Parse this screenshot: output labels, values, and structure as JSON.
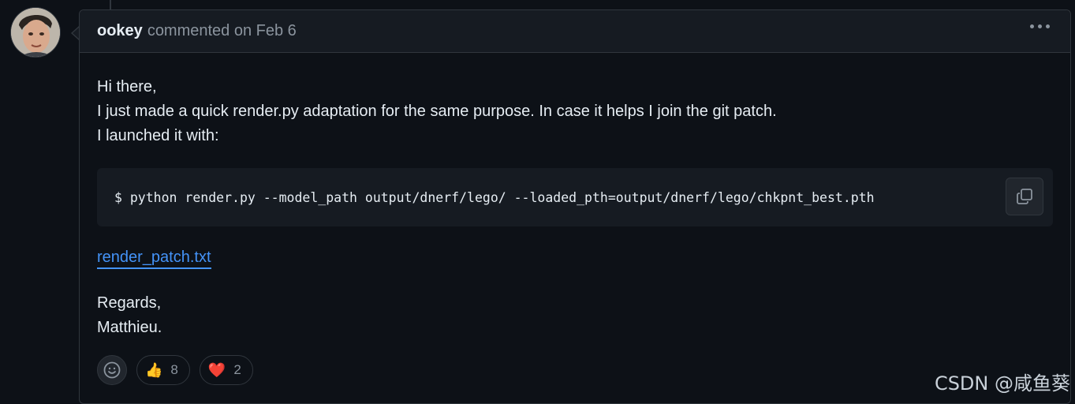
{
  "comment": {
    "author": "ookey",
    "meta": "commented on Feb 6",
    "body_lines": [
      "Hi there,",
      "I just made a quick render.py adaptation for the same purpose. In case it helps I join the git patch.",
      "I launched it with:"
    ],
    "code": "$ python render.py --model_path output/dnerf/lego/ --loaded_pth=output/dnerf/lego/chkpnt_best.pth",
    "attachment": "render_patch.txt",
    "signature_lines": [
      "Regards,",
      "Matthieu."
    ]
  },
  "reactions": [
    {
      "emoji": "👍",
      "icon": "thumbs-up-icon",
      "count": "8"
    },
    {
      "emoji": "❤️",
      "icon": "heart-icon",
      "count": "2"
    }
  ],
  "watermark": "CSDN @咸鱼葵",
  "colors": {
    "background": "#0d1117",
    "header": "#161b22",
    "border": "#30363d",
    "link": "#4493f8",
    "muted": "#8b949e",
    "text": "#e6edf3"
  }
}
